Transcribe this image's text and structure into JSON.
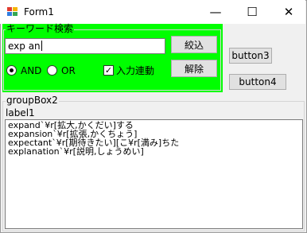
{
  "window": {
    "title": "Form1",
    "minimize_glyph": "—",
    "maximize_glyph": "☐",
    "close_glyph": "✕"
  },
  "group_keyword": {
    "title": "キーワード検索",
    "background_color": "#00ff00",
    "search_input_value": "exp an",
    "filter_button": "絞込",
    "clear_button": "解除",
    "radio_and": {
      "label": "AND",
      "checked": true
    },
    "radio_or": {
      "label": "OR",
      "checked": false
    },
    "checkbox_link": {
      "label": "入力連動",
      "checked": true
    }
  },
  "button3": {
    "label": "button3"
  },
  "button4": {
    "label": "button4"
  },
  "group_box2": {
    "title": "groupBox2",
    "label1": "label1",
    "results": [
      "expand`¥r[拡大,かくだい]する",
      "expansion`¥r[拡張,かくちょう]",
      "expectant`¥r[期待きたい][こ¥r[満み]ちた",
      "explanation`¥r[説明,しょうめい]"
    ]
  }
}
